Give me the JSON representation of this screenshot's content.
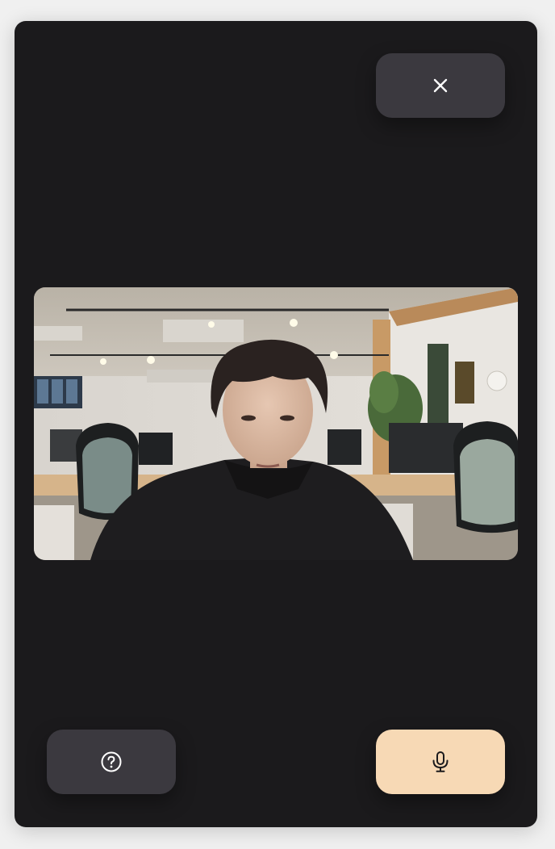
{
  "call": {
    "close_button": {
      "icon": "close-icon"
    },
    "help_button": {
      "icon": "question-circle-icon"
    },
    "mic_button": {
      "icon": "microphone-icon",
      "active": true
    },
    "video_feed": {
      "content": "camera-feed-person-in-office"
    }
  },
  "colors": {
    "background": "#1b1a1c",
    "button_dark": "#3b393f",
    "button_accent": "#f7d9b5",
    "icon_light": "#ffffff",
    "icon_dark": "#1b1a1c"
  }
}
